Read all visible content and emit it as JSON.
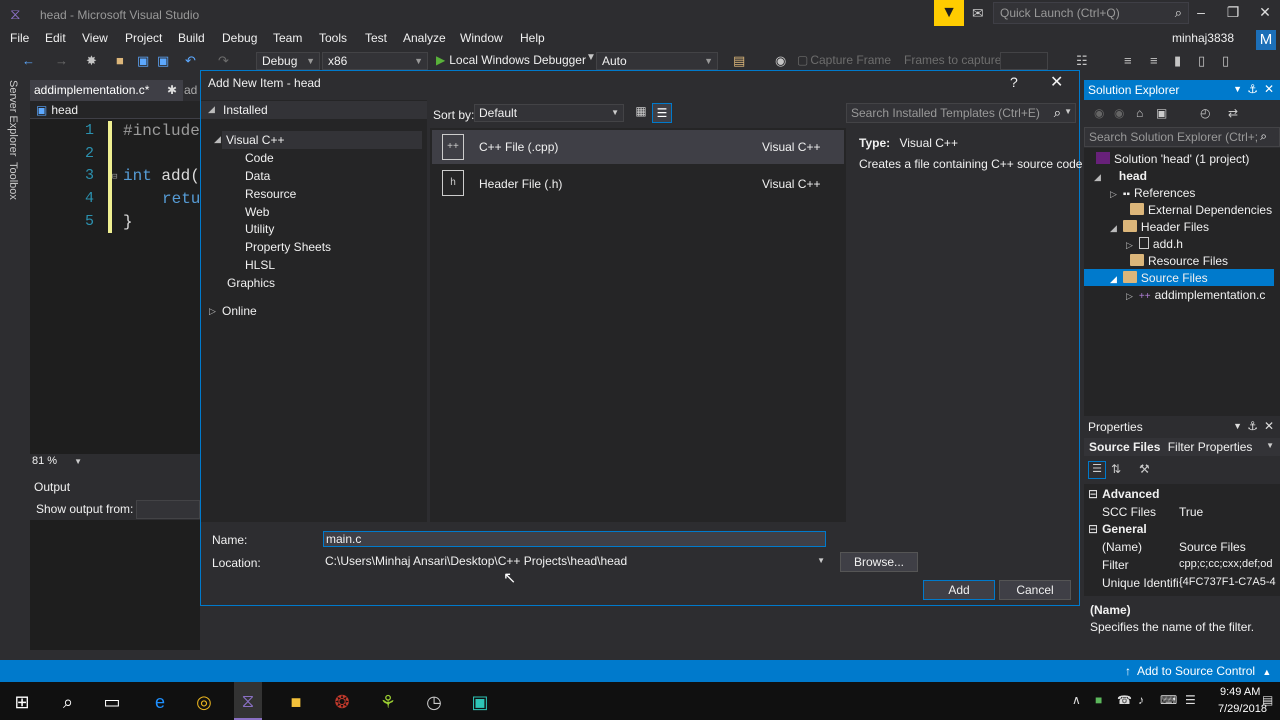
{
  "window": {
    "title": "head - Microsoft Visual Studio",
    "quick_launch_placeholder": "Quick Launch (Ctrl+Q)",
    "account": "minhaj3838",
    "avatar_letter": "M"
  },
  "menu": [
    "File",
    "Edit",
    "View",
    "Project",
    "Build",
    "Debug",
    "Team",
    "Tools",
    "Test",
    "Analyze",
    "Window",
    "Help"
  ],
  "toolbar": {
    "configuration": "Debug",
    "platform": "x86",
    "run_label": "Local Windows Debugger",
    "run_mode": "Auto",
    "capture_frame": "Capture Frame",
    "frames_to_capture": "Frames to capture:"
  },
  "editor": {
    "active_tab": "addimplementation.c*",
    "next_tab": "ad",
    "nav_scope": "head",
    "lines": [
      "1",
      "2",
      "3",
      "4",
      "5"
    ],
    "code": [
      "#include",
      "",
      "int add(",
      "retu",
      "}"
    ],
    "zoom": "81 %"
  },
  "side_tabs": [
    "Server Explorer",
    "Toolbox"
  ],
  "output": {
    "title": "Output",
    "show_from": "Show output from:"
  },
  "dialog": {
    "title": "Add New Item - head",
    "help": "?",
    "installed": "Installed",
    "tree": [
      "Visual C++",
      "Code",
      "Data",
      "Resource",
      "Web",
      "Utility",
      "Property Sheets",
      "HLSL",
      "Graphics",
      "Online"
    ],
    "sort_by_label": "Sort by:",
    "sort_by_value": "Default",
    "search_placeholder": "Search Installed Templates (Ctrl+E)",
    "templates": [
      {
        "name": "C++ File (.cpp)",
        "lang": "Visual C++"
      },
      {
        "name": "Header File (.h)",
        "lang": "Visual C++"
      }
    ],
    "type_label": "Type:",
    "type_value": "Visual C++",
    "type_desc": "Creates a file containing C++ source code",
    "name_label": "Name:",
    "name_value": "main.c",
    "location_label": "Location:",
    "location_value": "C:\\Users\\Minhaj Ansari\\Desktop\\C++ Projects\\head\\head",
    "browse": "Browse...",
    "add": "Add",
    "cancel": "Cancel"
  },
  "solution_explorer": {
    "title": "Solution Explorer",
    "search_placeholder": "Search Solution Explorer (Ctrl+;",
    "items": [
      "Solution 'head' (1 project)",
      "head",
      "References",
      "External Dependencies",
      "Header Files",
      "add.h",
      "Resource Files",
      "Source Files",
      "addimplementation.c"
    ]
  },
  "properties": {
    "title": "Properties",
    "object": "Source Files",
    "object_type": "Filter Properties",
    "cat_advanced": "Advanced",
    "scc_files_key": "SCC Files",
    "scc_files_val": "True",
    "cat_general": "General",
    "name_key": "(Name)",
    "name_val": "Source Files",
    "filter_key": "Filter",
    "filter_val": "cpp;c;cc;cxx;def;od",
    "unique_key": "Unique Identifi",
    "unique_val": "{4FC737F1-C7A5-4",
    "desc_title": "(Name)",
    "desc_text": "Specifies the name of the filter."
  },
  "statusbar": {
    "add_to_source": "Add to Source Control"
  },
  "clock": {
    "time": "9:49 AM",
    "date": "7/29/2018"
  },
  "colors": {
    "accent": "#007acc",
    "background": "#2d2d30",
    "run_green": "#59b23a",
    "filter_yellow": "#ffcc00"
  }
}
